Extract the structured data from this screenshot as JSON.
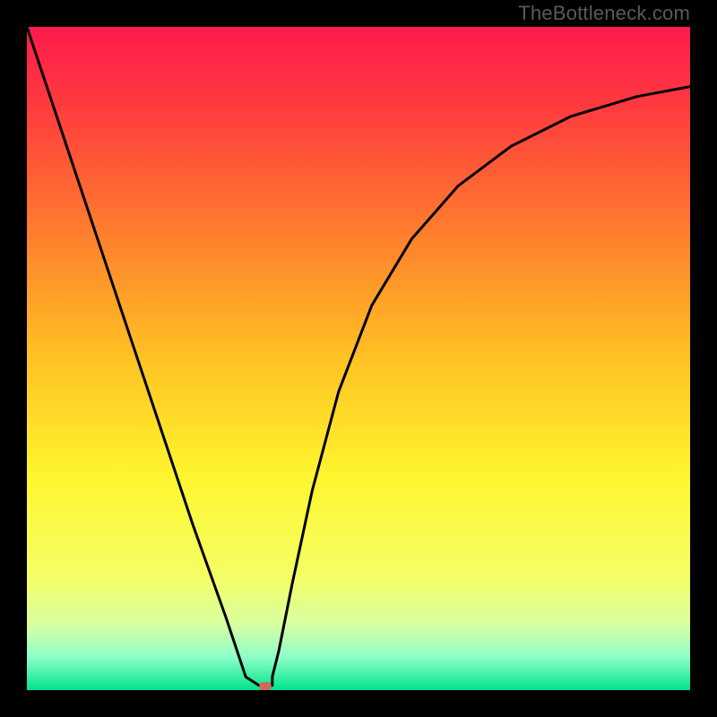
{
  "watermark": "TheBottleneck.com",
  "chart_data": {
    "type": "line",
    "title": "",
    "xlabel": "",
    "ylabel": "",
    "xlim": [
      0,
      100
    ],
    "ylim": [
      0,
      100
    ],
    "gradient_stops": [
      {
        "pos": 0,
        "color": "#ff1a4d"
      },
      {
        "pos": 12,
        "color": "#ff3b3e"
      },
      {
        "pos": 30,
        "color": "#ff7a2e"
      },
      {
        "pos": 50,
        "color": "#ffc223"
      },
      {
        "pos": 68,
        "color": "#fff62e"
      },
      {
        "pos": 83,
        "color": "#f4ff66"
      },
      {
        "pos": 90,
        "color": "#d9ffa0"
      },
      {
        "pos": 95,
        "color": "#8effc8"
      },
      {
        "pos": 100,
        "color": "#00e38a"
      }
    ],
    "series": [
      {
        "name": "bottleneck-curve",
        "x": [
          0,
          5,
          10,
          15,
          20,
          25,
          30,
          33,
          35,
          37,
          37,
          38,
          40,
          43,
          47,
          52,
          58,
          65,
          73,
          82,
          92,
          100
        ],
        "y": [
          100,
          85,
          70,
          55,
          40,
          25,
          11,
          2,
          0.7,
          0.7,
          2,
          6,
          16,
          30,
          45,
          58,
          68,
          76,
          82,
          86.5,
          89.5,
          91
        ]
      }
    ],
    "marker": {
      "x": 36,
      "y": 0.6,
      "color": "#cc6a5c"
    }
  }
}
